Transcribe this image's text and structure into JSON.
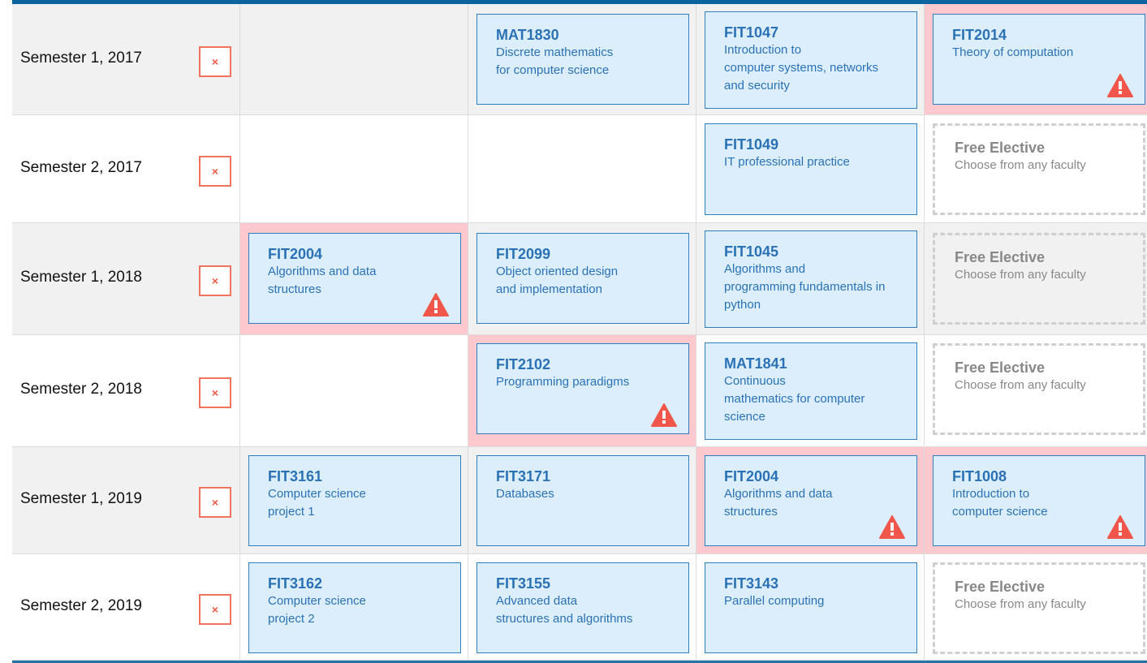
{
  "semesters": [
    {
      "label": "Semester 1, 2017",
      "remove": "×",
      "units": [
        null,
        {
          "code": "MAT1830",
          "lines": [
            "Discrete mathematics",
            "for computer science"
          ],
          "warning": false
        },
        {
          "code": "FIT1047",
          "lines": [
            "Introduction to",
            "computer systems, networks",
            "and security"
          ],
          "warning": false
        },
        {
          "code": "FIT2014",
          "lines": [
            "Theory of computation"
          ],
          "warning": true
        }
      ]
    },
    {
      "label": "Semester 2, 2017",
      "remove": "×",
      "units": [
        null,
        null,
        {
          "code": "FIT1049",
          "lines": [
            "IT professional practice"
          ],
          "warning": false
        },
        {
          "elective": true,
          "code": "Free Elective",
          "lines": [
            "Choose from any faculty"
          ]
        }
      ]
    },
    {
      "label": "Semester 1, 2018",
      "remove": "×",
      "units": [
        {
          "code": "FIT2004",
          "lines": [
            "Algorithms and data",
            "structures"
          ],
          "warning": true
        },
        {
          "code": "FIT2099",
          "lines": [
            "Object oriented design",
            "and implementation"
          ],
          "warning": false
        },
        {
          "code": "FIT1045",
          "lines": [
            "Algorithms and",
            "programming fundamentals in",
            "python"
          ],
          "warning": false
        },
        {
          "elective": true,
          "code": "Free Elective",
          "lines": [
            "Choose from any faculty"
          ]
        }
      ]
    },
    {
      "label": "Semester 2, 2018",
      "remove": "×",
      "units": [
        null,
        {
          "code": "FIT2102",
          "lines": [
            "Programming paradigms"
          ],
          "warning": true
        },
        {
          "code": "MAT1841",
          "lines": [
            "Continuous",
            "mathematics for computer",
            "science"
          ],
          "warning": false
        },
        {
          "elective": true,
          "code": "Free Elective",
          "lines": [
            "Choose from any faculty"
          ]
        }
      ]
    },
    {
      "label": "Semester 1, 2019",
      "remove": "×",
      "units": [
        {
          "code": "FIT3161",
          "lines": [
            "Computer science",
            "project 1"
          ],
          "warning": false
        },
        {
          "code": "FIT3171",
          "lines": [
            "Databases"
          ],
          "warning": false
        },
        {
          "code": "FIT2004",
          "lines": [
            "Algorithms and data",
            "structures"
          ],
          "warning": true
        },
        {
          "code": "FIT1008",
          "lines": [
            "Introduction to",
            "computer science"
          ],
          "warning": true
        }
      ]
    },
    {
      "label": "Semester 2, 2019",
      "remove": "×",
      "units": [
        {
          "code": "FIT3162",
          "lines": [
            "Computer science",
            "project 2"
          ],
          "warning": false
        },
        {
          "code": "FIT3155",
          "lines": [
            "Advanced data",
            "structures and algorithms"
          ],
          "warning": false
        },
        {
          "code": "FIT3143",
          "lines": [
            "Parallel computing"
          ],
          "warning": false
        },
        {
          "elective": true,
          "code": "Free Elective",
          "lines": [
            "Choose from any faculty"
          ]
        }
      ]
    }
  ],
  "colors": {
    "accent": "#0b64a0",
    "unit_bg": "#dceefc",
    "unit_text": "#2a72b5",
    "warning_bg": "#fdc9ce",
    "warning_icon": "#f0574a",
    "remove": "#ef5a45"
  }
}
